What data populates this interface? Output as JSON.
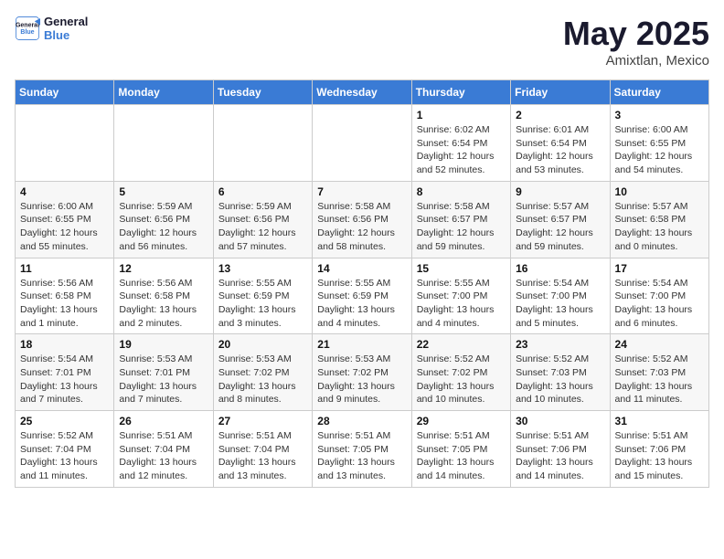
{
  "logo": {
    "line1": "General",
    "line2": "Blue"
  },
  "title": "May 2025",
  "subtitle": "Amixtlan, Mexico",
  "days_header": [
    "Sunday",
    "Monday",
    "Tuesday",
    "Wednesday",
    "Thursday",
    "Friday",
    "Saturday"
  ],
  "weeks": [
    [
      {
        "day": "",
        "info": ""
      },
      {
        "day": "",
        "info": ""
      },
      {
        "day": "",
        "info": ""
      },
      {
        "day": "",
        "info": ""
      },
      {
        "day": "1",
        "info": "Sunrise: 6:02 AM\nSunset: 6:54 PM\nDaylight: 12 hours\nand 52 minutes."
      },
      {
        "day": "2",
        "info": "Sunrise: 6:01 AM\nSunset: 6:54 PM\nDaylight: 12 hours\nand 53 minutes."
      },
      {
        "day": "3",
        "info": "Sunrise: 6:00 AM\nSunset: 6:55 PM\nDaylight: 12 hours\nand 54 minutes."
      }
    ],
    [
      {
        "day": "4",
        "info": "Sunrise: 6:00 AM\nSunset: 6:55 PM\nDaylight: 12 hours\nand 55 minutes."
      },
      {
        "day": "5",
        "info": "Sunrise: 5:59 AM\nSunset: 6:56 PM\nDaylight: 12 hours\nand 56 minutes."
      },
      {
        "day": "6",
        "info": "Sunrise: 5:59 AM\nSunset: 6:56 PM\nDaylight: 12 hours\nand 57 minutes."
      },
      {
        "day": "7",
        "info": "Sunrise: 5:58 AM\nSunset: 6:56 PM\nDaylight: 12 hours\nand 58 minutes."
      },
      {
        "day": "8",
        "info": "Sunrise: 5:58 AM\nSunset: 6:57 PM\nDaylight: 12 hours\nand 59 minutes."
      },
      {
        "day": "9",
        "info": "Sunrise: 5:57 AM\nSunset: 6:57 PM\nDaylight: 12 hours\nand 59 minutes."
      },
      {
        "day": "10",
        "info": "Sunrise: 5:57 AM\nSunset: 6:58 PM\nDaylight: 13 hours\nand 0 minutes."
      }
    ],
    [
      {
        "day": "11",
        "info": "Sunrise: 5:56 AM\nSunset: 6:58 PM\nDaylight: 13 hours\nand 1 minute."
      },
      {
        "day": "12",
        "info": "Sunrise: 5:56 AM\nSunset: 6:58 PM\nDaylight: 13 hours\nand 2 minutes."
      },
      {
        "day": "13",
        "info": "Sunrise: 5:55 AM\nSunset: 6:59 PM\nDaylight: 13 hours\nand 3 minutes."
      },
      {
        "day": "14",
        "info": "Sunrise: 5:55 AM\nSunset: 6:59 PM\nDaylight: 13 hours\nand 4 minutes."
      },
      {
        "day": "15",
        "info": "Sunrise: 5:55 AM\nSunset: 7:00 PM\nDaylight: 13 hours\nand 4 minutes."
      },
      {
        "day": "16",
        "info": "Sunrise: 5:54 AM\nSunset: 7:00 PM\nDaylight: 13 hours\nand 5 minutes."
      },
      {
        "day": "17",
        "info": "Sunrise: 5:54 AM\nSunset: 7:00 PM\nDaylight: 13 hours\nand 6 minutes."
      }
    ],
    [
      {
        "day": "18",
        "info": "Sunrise: 5:54 AM\nSunset: 7:01 PM\nDaylight: 13 hours\nand 7 minutes."
      },
      {
        "day": "19",
        "info": "Sunrise: 5:53 AM\nSunset: 7:01 PM\nDaylight: 13 hours\nand 7 minutes."
      },
      {
        "day": "20",
        "info": "Sunrise: 5:53 AM\nSunset: 7:02 PM\nDaylight: 13 hours\nand 8 minutes."
      },
      {
        "day": "21",
        "info": "Sunrise: 5:53 AM\nSunset: 7:02 PM\nDaylight: 13 hours\nand 9 minutes."
      },
      {
        "day": "22",
        "info": "Sunrise: 5:52 AM\nSunset: 7:02 PM\nDaylight: 13 hours\nand 10 minutes."
      },
      {
        "day": "23",
        "info": "Sunrise: 5:52 AM\nSunset: 7:03 PM\nDaylight: 13 hours\nand 10 minutes."
      },
      {
        "day": "24",
        "info": "Sunrise: 5:52 AM\nSunset: 7:03 PM\nDaylight: 13 hours\nand 11 minutes."
      }
    ],
    [
      {
        "day": "25",
        "info": "Sunrise: 5:52 AM\nSunset: 7:04 PM\nDaylight: 13 hours\nand 11 minutes."
      },
      {
        "day": "26",
        "info": "Sunrise: 5:51 AM\nSunset: 7:04 PM\nDaylight: 13 hours\nand 12 minutes."
      },
      {
        "day": "27",
        "info": "Sunrise: 5:51 AM\nSunset: 7:04 PM\nDaylight: 13 hours\nand 13 minutes."
      },
      {
        "day": "28",
        "info": "Sunrise: 5:51 AM\nSunset: 7:05 PM\nDaylight: 13 hours\nand 13 minutes."
      },
      {
        "day": "29",
        "info": "Sunrise: 5:51 AM\nSunset: 7:05 PM\nDaylight: 13 hours\nand 14 minutes."
      },
      {
        "day": "30",
        "info": "Sunrise: 5:51 AM\nSunset: 7:06 PM\nDaylight: 13 hours\nand 14 minutes."
      },
      {
        "day": "31",
        "info": "Sunrise: 5:51 AM\nSunset: 7:06 PM\nDaylight: 13 hours\nand 15 minutes."
      }
    ]
  ]
}
